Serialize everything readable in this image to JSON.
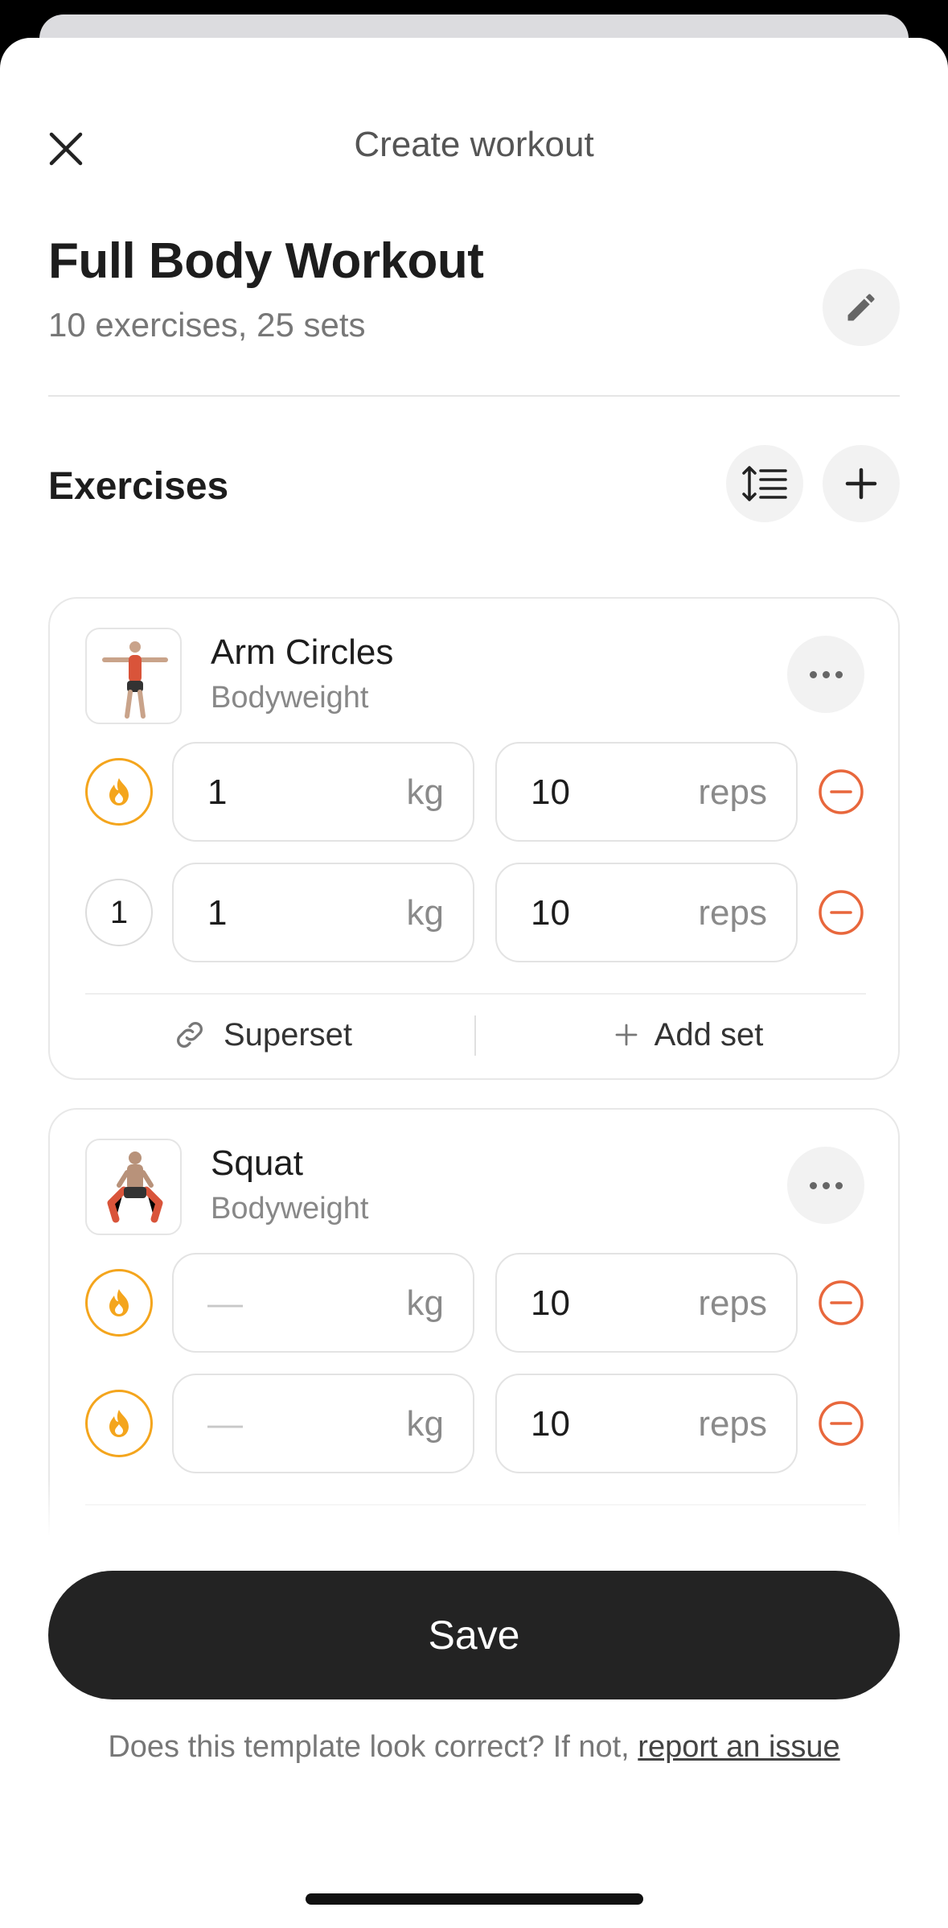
{
  "nav": {
    "title": "Create workout"
  },
  "workout": {
    "title": "Full Body Workout",
    "summary": "10 exercises, 25 sets"
  },
  "exercises_section": {
    "title": "Exercises"
  },
  "exercises": [
    {
      "name": "Arm Circles",
      "category": "Bodyweight",
      "sets": [
        {
          "type": "warmup",
          "weight": "1",
          "weight_unit": "kg",
          "reps": "10",
          "reps_unit": "reps"
        },
        {
          "type": "normal",
          "label": "1",
          "weight": "1",
          "weight_unit": "kg",
          "reps": "10",
          "reps_unit": "reps"
        }
      ],
      "actions": {
        "superset": "Superset",
        "add_set": "Add set"
      }
    },
    {
      "name": "Squat",
      "category": "Bodyweight",
      "sets": [
        {
          "type": "warmup",
          "weight": "—",
          "weight_unit": "kg",
          "reps": "10",
          "reps_unit": "reps"
        },
        {
          "type": "warmup",
          "weight": "—",
          "weight_unit": "kg",
          "reps": "10",
          "reps_unit": "reps"
        }
      ]
    }
  ],
  "save_label": "Save",
  "footer": {
    "text": "Does this template look correct? If not, ",
    "link": "report an issue"
  },
  "colors": {
    "warmup": "#f4a51d",
    "remove": "#e8673c",
    "primary_button": "#232323"
  },
  "icons": {
    "close": "close-icon",
    "edit": "pencil-icon",
    "reorder": "reorder-icon",
    "add": "plus-icon",
    "more": "more-icon",
    "warmup": "flame-icon",
    "remove": "minus-circle-icon",
    "superset": "link-icon",
    "add_set": "plus-icon"
  }
}
